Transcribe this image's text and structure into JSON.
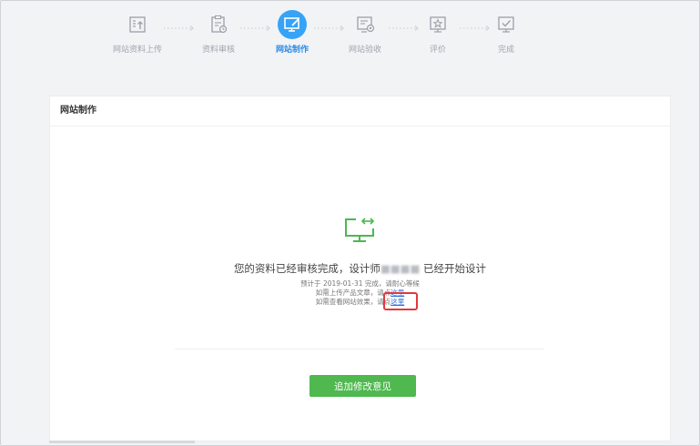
{
  "stepper": {
    "steps": [
      {
        "label": "网站资料上传",
        "icon": "upload-doc-icon"
      },
      {
        "label": "资料审核",
        "icon": "clipboard-icon"
      },
      {
        "label": "网站制作",
        "icon": "monitor-edit-icon"
      },
      {
        "label": "网站验收",
        "icon": "review-icon"
      },
      {
        "label": "评价",
        "icon": "star-icon"
      },
      {
        "label": "完成",
        "icon": "check-icon"
      }
    ],
    "current_step": 3
  },
  "card": {
    "title": "网站制作",
    "icon": "monitor-sync-icon",
    "message_prefix": "您的资料已经审核完成，设计师",
    "designer_name": "■■■■",
    "message_suffix": " 已经开始设计",
    "estimate_line": "预计于 2019-01-31 完成，请耐心等候",
    "upload_prefix": "如需上传产品文章，请点",
    "upload_link": "这里",
    "view_prefix": "如需查看网站效果，请点",
    "view_link": "这里",
    "button_label": "追加修改意见"
  },
  "colors": {
    "accent": "#36a3f7",
    "active_text": "#2f8be6",
    "button": "#4fb84f",
    "highlight": "#e0393e",
    "icon_green": "#4cb84f"
  }
}
